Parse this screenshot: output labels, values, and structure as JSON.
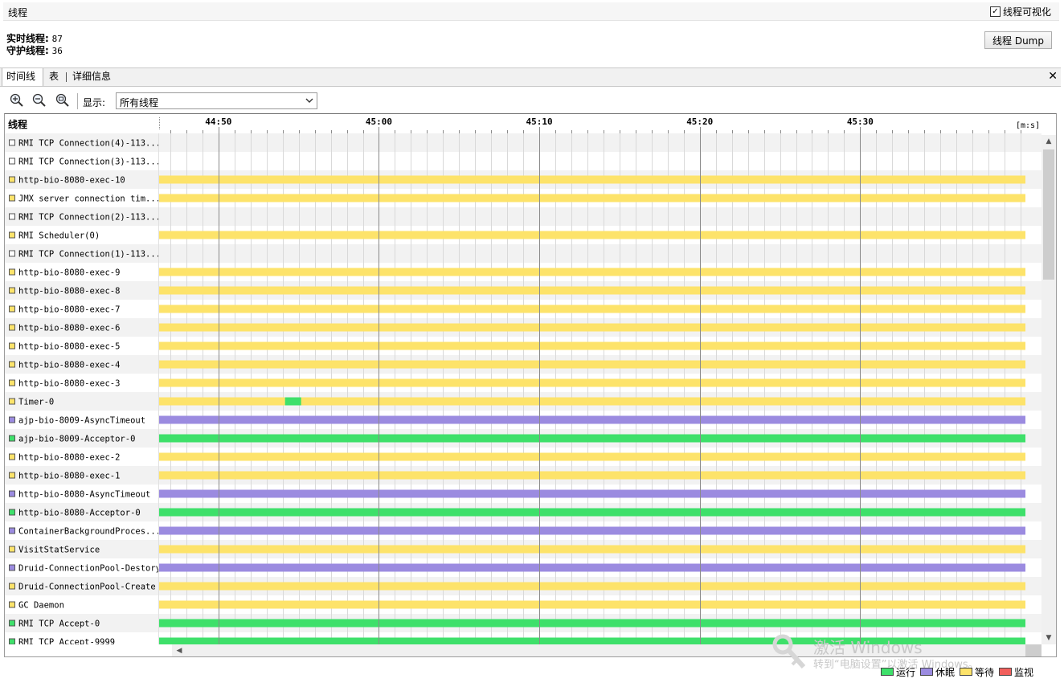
{
  "header": {
    "title": "线程",
    "visualize_label": "线程可视化",
    "visualize_checked": true
  },
  "stats": {
    "live_label": "实时线程:",
    "live_value": "87",
    "daemon_label": "守护线程:",
    "daemon_value": "36"
  },
  "dump_button": "线程 Dump",
  "tabs": [
    {
      "label": "时间线",
      "active": true
    },
    {
      "label": "表",
      "active": false
    },
    {
      "label": "详细信息",
      "active": false
    }
  ],
  "toolbar": {
    "show_label": "显示:",
    "show_value": "所有线程"
  },
  "timeline": {
    "column_header": "线程",
    "unit_label": "[m:s]",
    "axis": {
      "start_s": 2686.3,
      "end_s": 2740.3
    },
    "major_ticks": [
      {
        "label": "44:50",
        "t": 2690
      },
      {
        "label": "45:00",
        "t": 2700
      },
      {
        "label": "45:10",
        "t": 2710
      },
      {
        "label": "45:20",
        "t": 2720
      },
      {
        "label": "45:30",
        "t": 2730
      }
    ],
    "threads": [
      {
        "name": "RMI TCP Connection(4)-113...",
        "state": "none"
      },
      {
        "name": "RMI TCP Connection(3)-113...",
        "state": "none"
      },
      {
        "name": "http-bio-8080-exec-10",
        "state": "wait"
      },
      {
        "name": "JMX server connection tim...",
        "state": "wait"
      },
      {
        "name": "RMI TCP Connection(2)-113...",
        "state": "none"
      },
      {
        "name": "RMI Scheduler(0)",
        "state": "wait"
      },
      {
        "name": "RMI TCP Connection(1)-113...",
        "state": "none"
      },
      {
        "name": "http-bio-8080-exec-9",
        "state": "wait"
      },
      {
        "name": "http-bio-8080-exec-8",
        "state": "wait"
      },
      {
        "name": "http-bio-8080-exec-7",
        "state": "wait"
      },
      {
        "name": "http-bio-8080-exec-6",
        "state": "wait"
      },
      {
        "name": "http-bio-8080-exec-5",
        "state": "wait"
      },
      {
        "name": "http-bio-8080-exec-4",
        "state": "wait"
      },
      {
        "name": "http-bio-8080-exec-3",
        "state": "wait"
      },
      {
        "name": "Timer-0",
        "state": "wait",
        "run_segments": [
          [
            2694.15,
            2695.15
          ]
        ]
      },
      {
        "name": "ajp-bio-8009-AsyncTimeout",
        "state": "sleep"
      },
      {
        "name": "ajp-bio-8009-Acceptor-0",
        "state": "run"
      },
      {
        "name": "http-bio-8080-exec-2",
        "state": "wait"
      },
      {
        "name": "http-bio-8080-exec-1",
        "state": "wait"
      },
      {
        "name": "http-bio-8080-AsyncTimeout",
        "state": "sleep"
      },
      {
        "name": "http-bio-8080-Acceptor-0",
        "state": "run"
      },
      {
        "name": "ContainerBackgroundProces...",
        "state": "sleep"
      },
      {
        "name": "VisitStatService",
        "state": "wait"
      },
      {
        "name": "Druid-ConnectionPool-Destory",
        "state": "sleep"
      },
      {
        "name": "Druid-ConnectionPool-Create",
        "state": "wait"
      },
      {
        "name": "GC Daemon",
        "state": "wait"
      },
      {
        "name": "RMI TCP Accept-0",
        "state": "run"
      },
      {
        "name": "RMI TCP Accept-9999",
        "state": "run"
      }
    ]
  },
  "colors": {
    "run": "#3ee06a",
    "sleep": "#9b8be0",
    "wait": "#fde36a",
    "monitor": "#f25f5c",
    "none": "#ffffff"
  },
  "legend": [
    {
      "key": "run",
      "label": "运行"
    },
    {
      "key": "sleep",
      "label": "休眠"
    },
    {
      "key": "wait",
      "label": "等待"
    },
    {
      "key": "monitor",
      "label": "监视"
    }
  ],
  "watermark": {
    "line1": "激活 Windows",
    "line2": "转到“电脑设置”以激活 Windows。"
  }
}
